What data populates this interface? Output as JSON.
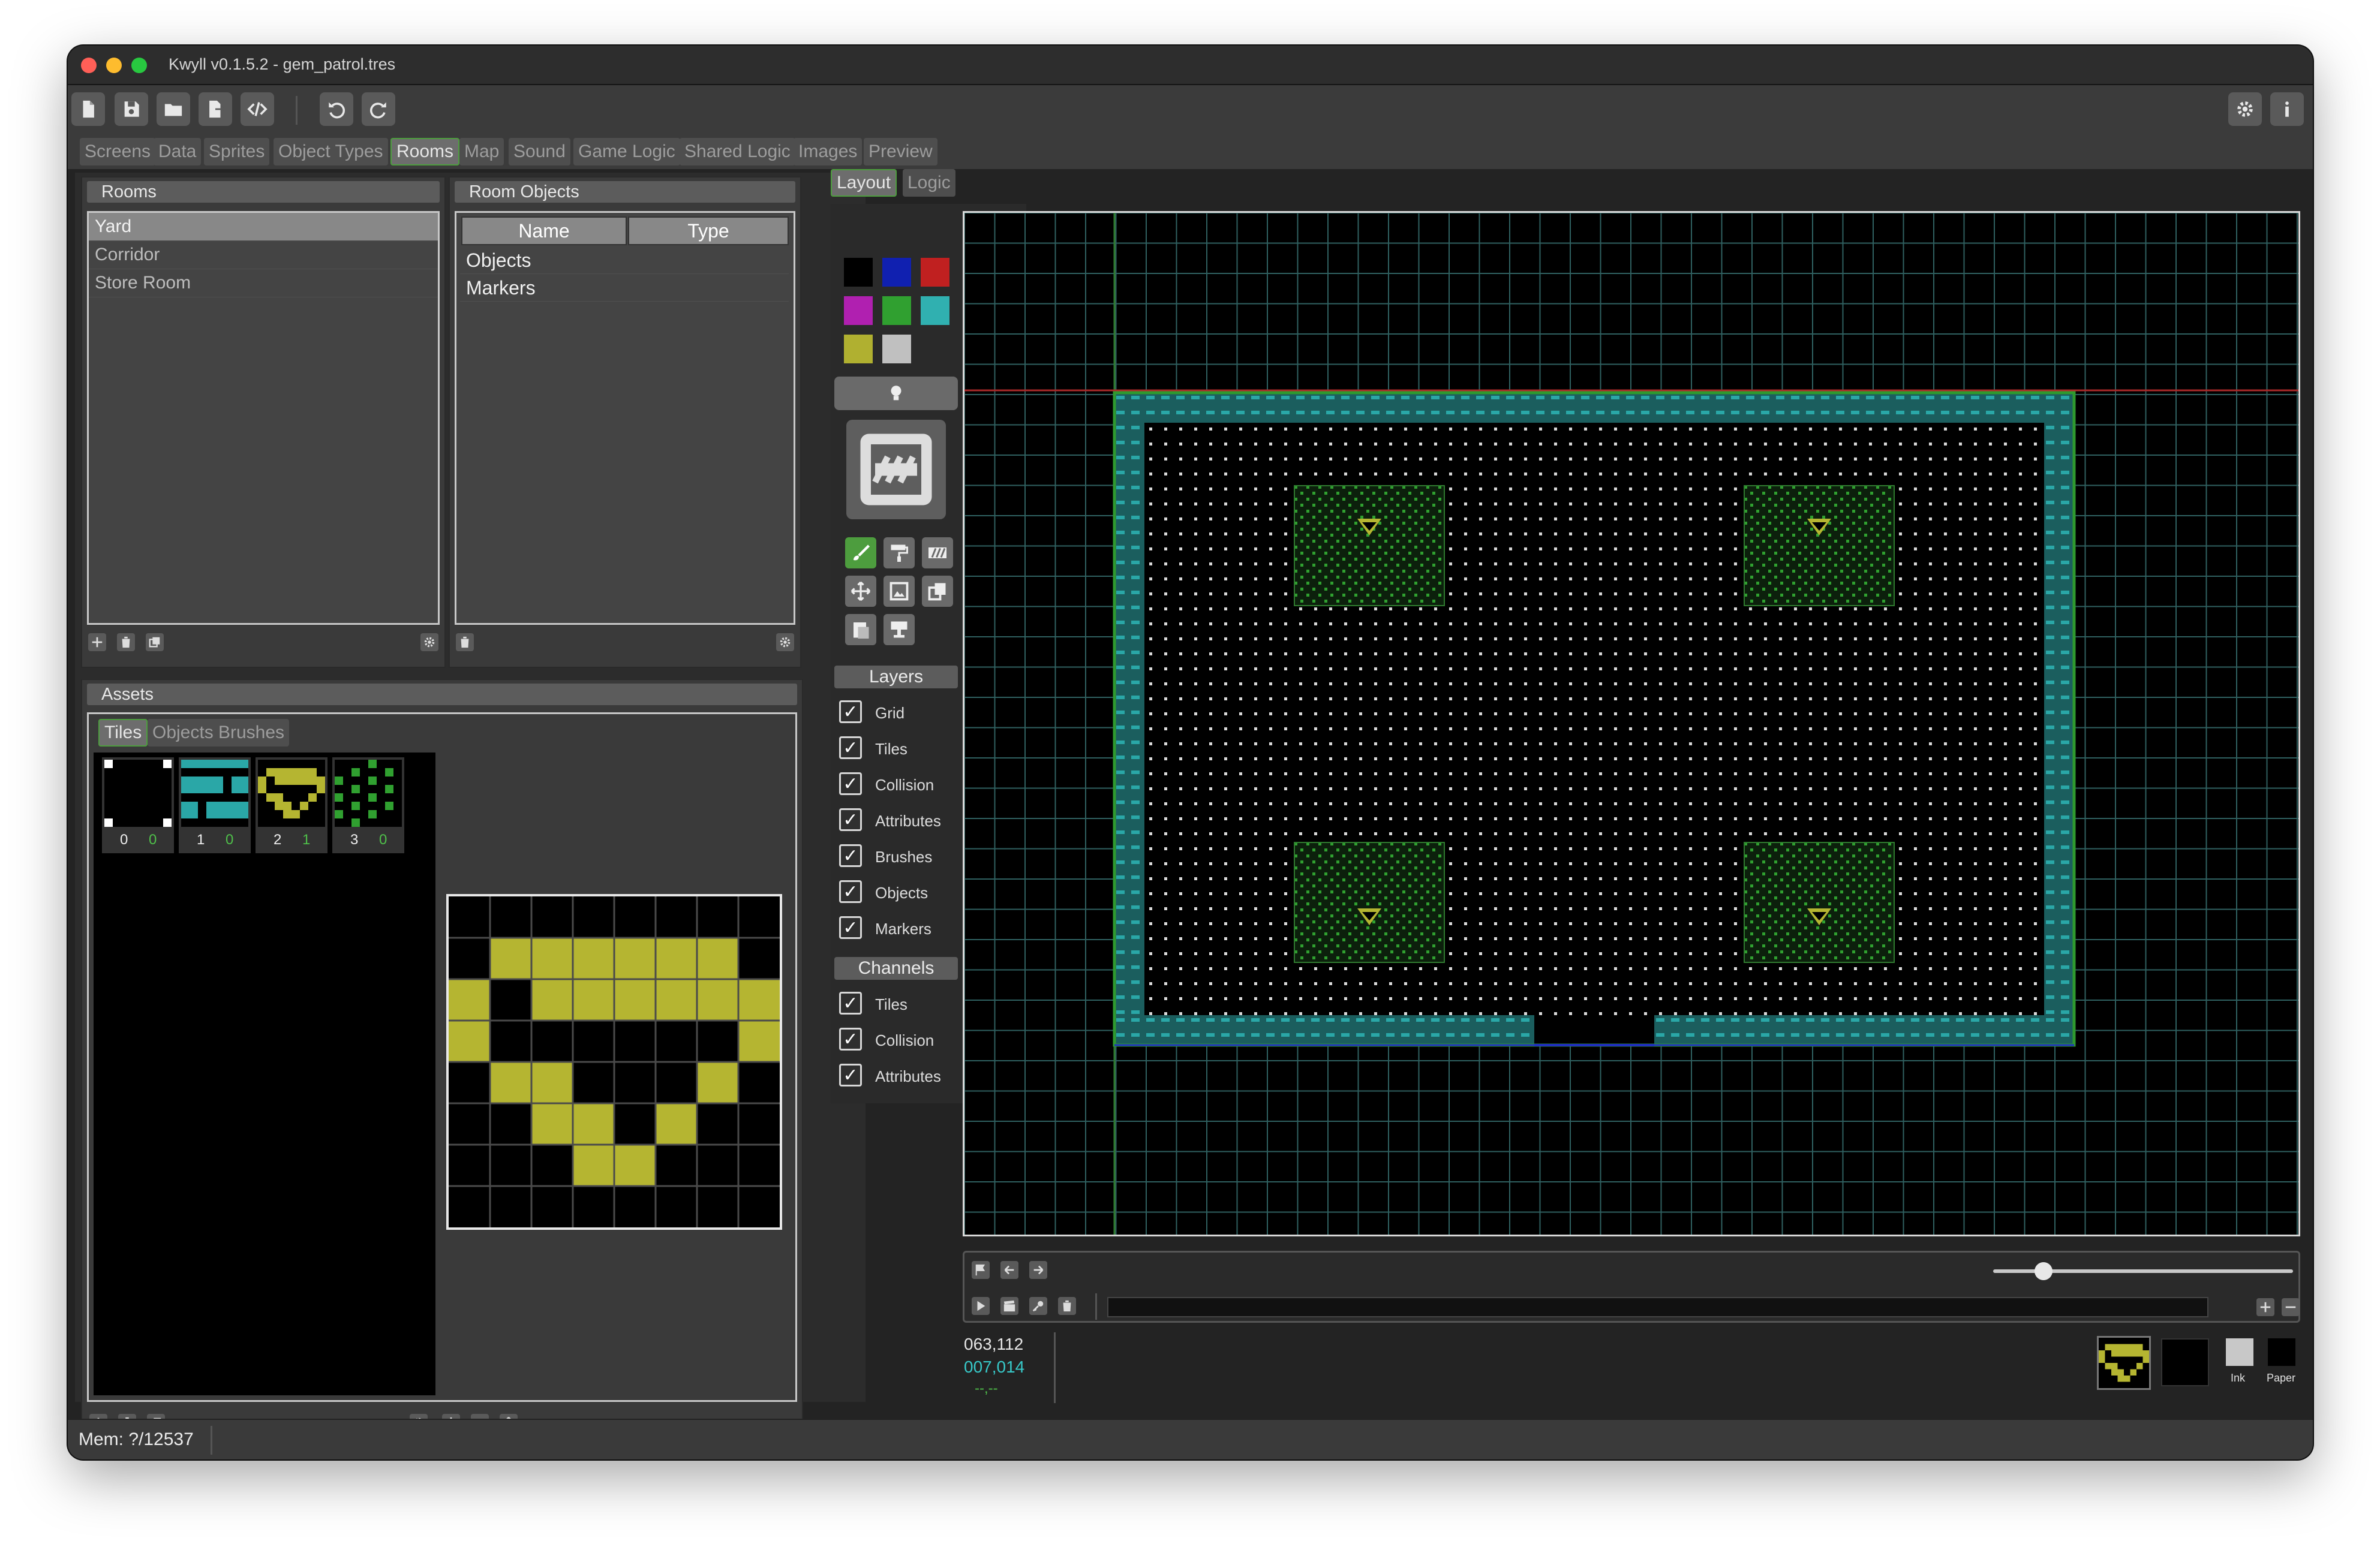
{
  "window": {
    "title": "Kwyll v0.1.5.2 - gem_patrol.tres"
  },
  "toolbar": {
    "icons": [
      "new-file-icon",
      "save-icon",
      "open-folder-icon",
      "export-icon",
      "code-icon",
      "undo-icon",
      "redo-icon",
      "settings-icon",
      "info-icon"
    ]
  },
  "main_tabs": [
    "Screens",
    "Data",
    "Sprites",
    "Object Types",
    "Rooms",
    "Map",
    "Sound",
    "Game Logic",
    "Shared Logic",
    "Images",
    "Preview"
  ],
  "active_main_tab": "Rooms",
  "rooms_panel": {
    "title": "Rooms",
    "items": [
      "Yard",
      "Corridor",
      "Store Room"
    ],
    "selected": "Yard"
  },
  "room_objects_panel": {
    "title": "Room Objects",
    "columns": [
      "Name",
      "Type"
    ],
    "rows": [
      "Objects",
      "Markers"
    ]
  },
  "assets_panel": {
    "title": "Assets",
    "tabs": [
      "Tiles",
      "Objects",
      "Brushes"
    ],
    "active_tab": "Tiles",
    "tiles": [
      {
        "index": "0",
        "sub": "0"
      },
      {
        "index": "1",
        "sub": "0"
      },
      {
        "index": "2",
        "sub": "1"
      },
      {
        "index": "3",
        "sub": "0"
      }
    ]
  },
  "editor_tabs": {
    "layout": "Layout",
    "logic": "Logic",
    "active": "Layout"
  },
  "palette": [
    "#000000",
    "#1020b0",
    "#c02020",
    "#b020b0",
    "#30a030",
    "#30b0b0",
    "#b0b030",
    "#c0c0c0"
  ],
  "layers": {
    "title": "Layers",
    "items": [
      "Grid",
      "Tiles",
      "Collision",
      "Attributes",
      "Brushes",
      "Objects",
      "Markers"
    ]
  },
  "channels": {
    "title": "Channels",
    "items": [
      "Tiles",
      "Collision",
      "Attributes"
    ]
  },
  "status": {
    "coords_primary": "063,112",
    "coords_secondary": "007,014",
    "coords_tertiary": "--,--",
    "ink_label": "Ink",
    "paper_label": "Paper",
    "memory": "Mem: ?/12537"
  },
  "colors": {
    "accent_green": "#4d9d3e",
    "tile_cyan": "#2aa7a7",
    "gem_yellow": "#b5b531",
    "grid_line": "#2f6060"
  }
}
